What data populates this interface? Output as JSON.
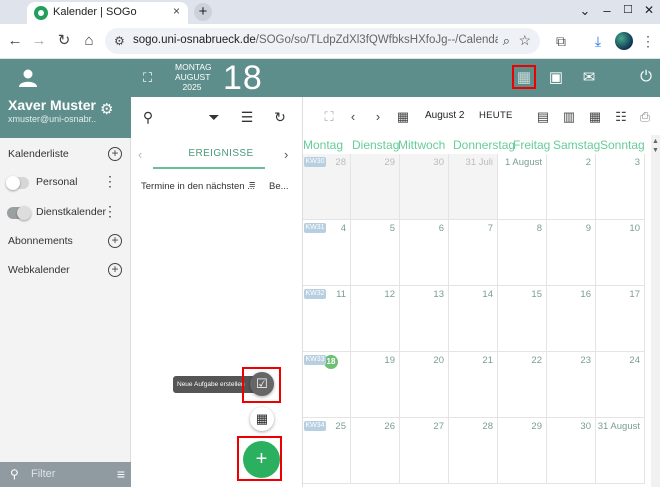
{
  "browser": {
    "tab_title": "Kalender | SOGo",
    "tab_close": "×",
    "new_tab": "+",
    "url_host": "sogo.uni-osnabrueck.de",
    "url_path": "/SOGo/so/TLdpZdXl3fQWfbksHXfoJg--/Calendar/view#!...",
    "window_controls": [
      "⌄",
      "–",
      "☐",
      "✕"
    ]
  },
  "profile": {
    "name": "Xaver Muster",
    "email": "xmuster@uni-osnabr..."
  },
  "sidebar": {
    "calendar_list_label": "Kalenderliste",
    "calendars": [
      {
        "label": "Personal",
        "enabled": false
      },
      {
        "label": "Dienstkalender",
        "enabled": true
      }
    ],
    "subscriptions_label": "Abonnements",
    "webcalendars_label": "Webkalender",
    "filter_placeholder": "Filter"
  },
  "topbar": {
    "weekday": "MONTAG",
    "month": "AUGUST",
    "year": "2025",
    "day": "18"
  },
  "list": {
    "tab_label": "EREIGNISSE",
    "filter_label": "Termine in den nächsten ...",
    "sort_label": "Be..."
  },
  "fab": {
    "tooltip": "Neue Aufgabe erstellen",
    "main_symbol": "+"
  },
  "calendar": {
    "month_label": "August 2025",
    "today_button": "HEUTE",
    "weekdays": [
      "Montag",
      "Dienstag",
      "Mittwoch",
      "Donnerstag",
      "Freitag",
      "Samstag",
      "Sonntag"
    ],
    "weeks": [
      {
        "kw": "KW30",
        "days": [
          {
            "n": "28",
            "out": true
          },
          {
            "n": "29",
            "out": true
          },
          {
            "n": "30",
            "out": true
          },
          {
            "n": "31 Juli",
            "out": true
          },
          {
            "n": "1 August",
            "out": false
          },
          {
            "n": "2",
            "out": false
          },
          {
            "n": "3",
            "out": false
          }
        ]
      },
      {
        "kw": "KW31",
        "days": [
          {
            "n": "4"
          },
          {
            "n": "5"
          },
          {
            "n": "6"
          },
          {
            "n": "7"
          },
          {
            "n": "8"
          },
          {
            "n": "9"
          },
          {
            "n": "10"
          }
        ]
      },
      {
        "kw": "KW32",
        "days": [
          {
            "n": "11"
          },
          {
            "n": "12"
          },
          {
            "n": "13"
          },
          {
            "n": "14"
          },
          {
            "n": "15"
          },
          {
            "n": "16"
          },
          {
            "n": "17"
          }
        ]
      },
      {
        "kw": "KW33",
        "days": [
          {
            "n": "18",
            "today": true
          },
          {
            "n": "19"
          },
          {
            "n": "20"
          },
          {
            "n": "21"
          },
          {
            "n": "22"
          },
          {
            "n": "23"
          },
          {
            "n": "24"
          }
        ]
      },
      {
        "kw": "KW34",
        "days": [
          {
            "n": "25"
          },
          {
            "n": "26"
          },
          {
            "n": "27"
          },
          {
            "n": "28"
          },
          {
            "n": "29"
          },
          {
            "n": "30"
          },
          {
            "n": "31 August"
          }
        ]
      }
    ]
  },
  "colors": {
    "header_teal": "#5d8e8b",
    "accent_green": "#2bb05f",
    "highlight_red": "#e00000"
  }
}
